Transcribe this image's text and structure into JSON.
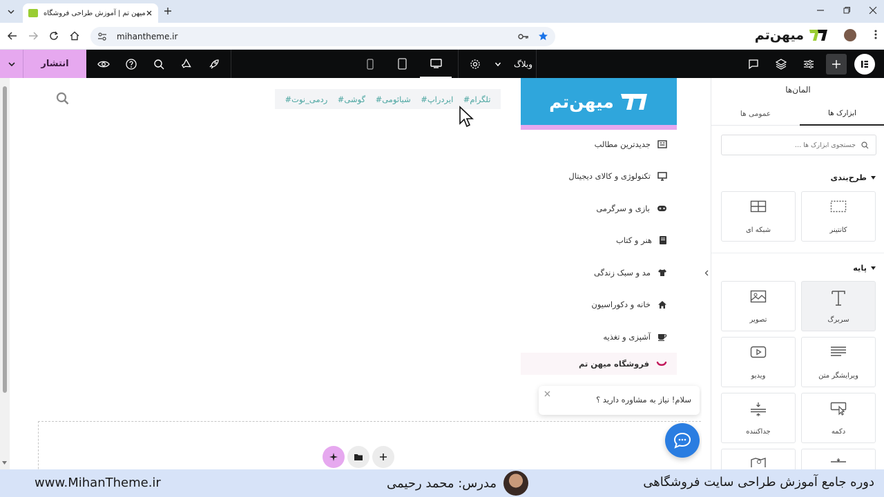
{
  "browser": {
    "tab_title": "میهن تم | آموزش طراحی فروشگاه",
    "url": "mihantheme.ir",
    "brand": "میهن‌تم"
  },
  "topbar": {
    "publish_label": "انتشار",
    "document_label": "وبلاگ"
  },
  "panel": {
    "title": "المان‌ها",
    "tabs": [
      "ابزارک ها",
      "عمومی ها"
    ],
    "search_placeholder": "جستجوی ابزارک ها ...",
    "sections": [
      {
        "title": "طرح‌بندی",
        "widgets": [
          "کانتینر",
          "شبکه ای"
        ]
      },
      {
        "title": "پایه",
        "widgets": [
          "سربرگ",
          "تصویر",
          "ویرایشگر متن",
          "ویدیو",
          "دکمه",
          "جداکننده"
        ]
      }
    ]
  },
  "canvas": {
    "tags": [
      "#تلگرام",
      "#ایردراپ",
      "#شیائومی",
      "#گوشی",
      "#ردمی_نوت"
    ],
    "categories": [
      {
        "label": "جدیدترین مطالب",
        "icon": "newspaper-icon"
      },
      {
        "label": "تکنولوژی و کالای دیجیتال",
        "icon": "monitor-icon"
      },
      {
        "label": "بازی و سرگرمی",
        "icon": "gamepad-icon"
      },
      {
        "label": "هنر و کتاب",
        "icon": "book-icon"
      },
      {
        "label": "مد و سبک زندگی",
        "icon": "tshirt-icon"
      },
      {
        "label": "خانه و دکوراسیون",
        "icon": "home-icon"
      },
      {
        "label": "آشپزی و تغذیه",
        "icon": "coffee-icon"
      }
    ],
    "shop_label": "فروشگاه میهن تم",
    "chat_message": "سلام! نیاز به مشاوره دارید ؟"
  },
  "footer": {
    "course_title": "دوره جامع آموزش طراحی سایت فروشگاهی",
    "instructor": "مدرس: محمد رحیمی",
    "website": "www.MihanTheme.ir"
  },
  "colors": {
    "accent_pink": "#e6a8ef",
    "logo_blue": "#2fa6dc",
    "chat_blue": "#2a7de1",
    "brand_green": "#9acd32"
  }
}
